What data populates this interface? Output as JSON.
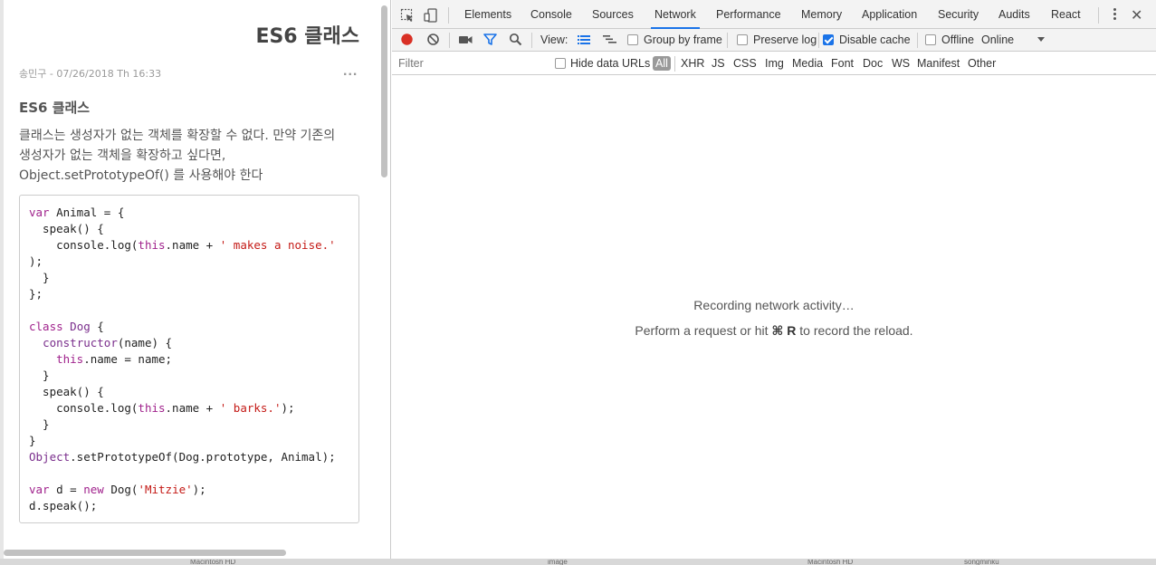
{
  "page": {
    "title": "ES6 클래스",
    "meta": "송민구 - 07/26/2018 Th 16:33",
    "more": "...",
    "heading": "ES6 클래스",
    "body_line1": "클래스는 생성자가 없는 객체를 확장할 수 없다. 만약 기존의",
    "body_line2": "생성자가 없는 객체을 확장하고 싶다면,",
    "body_line3": "Object.setPrototypeOf() 를 사용해야 한다"
  },
  "code": [
    [
      [
        "kw",
        "var"
      ],
      [
        "t",
        " Animal = {"
      ]
    ],
    [
      [
        "t",
        "  speak() {"
      ]
    ],
    [
      [
        "t",
        "    console.log("
      ],
      [
        "kw",
        "this"
      ],
      [
        "t",
        ".name + "
      ],
      [
        "str",
        "' makes a noise.'"
      ]
    ],
    [
      [
        "t",
        ");"
      ]
    ],
    [
      [
        "t",
        "  }"
      ]
    ],
    [
      [
        "t",
        "};"
      ]
    ],
    [
      [
        "t",
        ""
      ]
    ],
    [
      [
        "kw",
        "class"
      ],
      [
        "t",
        " "
      ],
      [
        "cl",
        "Dog"
      ],
      [
        "t",
        " {"
      ]
    ],
    [
      [
        "t",
        "  "
      ],
      [
        "cl",
        "constructor"
      ],
      [
        "t",
        "(name) {"
      ]
    ],
    [
      [
        "t",
        "    "
      ],
      [
        "kw",
        "this"
      ],
      [
        "t",
        ".name = name;"
      ]
    ],
    [
      [
        "t",
        "  }"
      ]
    ],
    [
      [
        "t",
        "  speak() {"
      ]
    ],
    [
      [
        "t",
        "    console.log("
      ],
      [
        "kw",
        "this"
      ],
      [
        "t",
        ".name + "
      ],
      [
        "str",
        "' barks.'"
      ],
      [
        "t",
        ");"
      ]
    ],
    [
      [
        "t",
        "  }"
      ]
    ],
    [
      [
        "t",
        "}"
      ]
    ],
    [
      [
        "cl",
        "Object"
      ],
      [
        "t",
        ".setPrototypeOf(Dog.prototype, Animal);"
      ]
    ],
    [
      [
        "t",
        ""
      ]
    ],
    [
      [
        "kw",
        "var"
      ],
      [
        "t",
        " d = "
      ],
      [
        "kw",
        "new"
      ],
      [
        "t",
        " Dog("
      ],
      [
        "str",
        "'Mitzie'"
      ],
      [
        "t",
        ");"
      ]
    ],
    [
      [
        "t",
        "d.speak();"
      ]
    ]
  ],
  "devtools": {
    "tabs": [
      "Elements",
      "Console",
      "Sources",
      "Network",
      "Performance",
      "Memory",
      "Application",
      "Security",
      "Audits",
      "React"
    ],
    "active_tab": "Network",
    "toolbar": {
      "view_label": "View:",
      "group_by_frame": "Group by frame",
      "preserve_log": "Preserve log",
      "disable_cache": "Disable cache",
      "offline": "Offline",
      "throttle": "Online",
      "group_by_frame_checked": false,
      "preserve_log_checked": false,
      "disable_cache_checked": true,
      "offline_checked": false
    },
    "filter": {
      "placeholder": "Filter",
      "hide_data_urls": "Hide data URLs",
      "types": [
        "All",
        "XHR",
        "JS",
        "CSS",
        "Img",
        "Media",
        "Font",
        "Doc",
        "WS",
        "Manifest",
        "Other"
      ],
      "active_type": "All"
    },
    "empty": {
      "line1": "Recording network activity…",
      "line2_prefix": "Perform a request or hit ",
      "shortcut": "⌘ R",
      "line2_suffix": " to record the reload."
    }
  },
  "taskbar": [
    "Macintosh HD",
    "image",
    "Macintosh HD",
    "songminku"
  ],
  "colors": {
    "accent": "#1a73e8",
    "record": "#d93025"
  }
}
